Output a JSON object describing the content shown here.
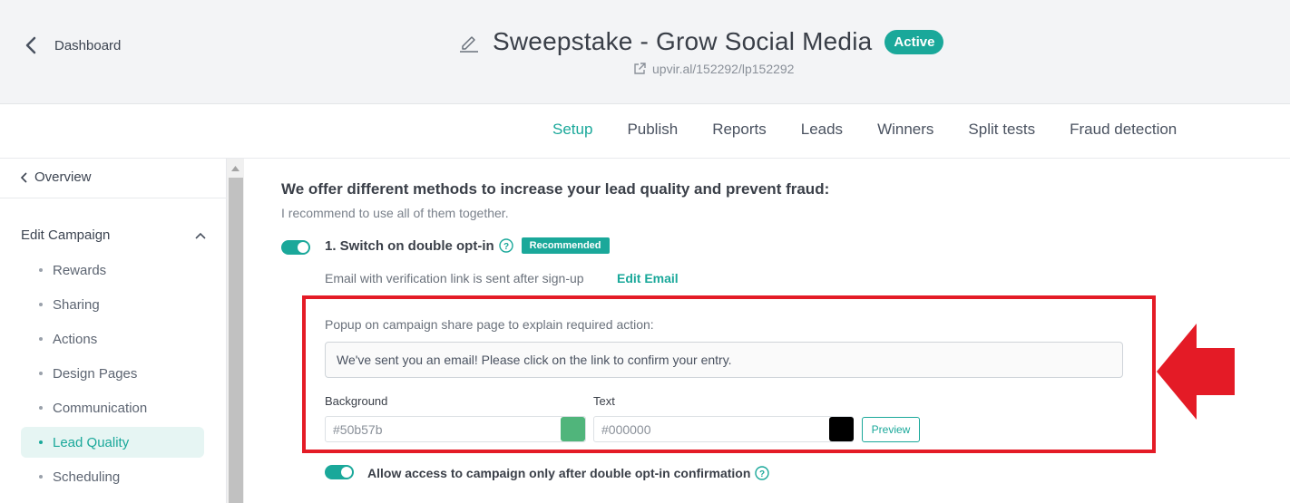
{
  "header": {
    "back_label": "Dashboard",
    "title": "Sweepstake - Grow Social Media",
    "status": "Active",
    "url": "upvir.al/152292/lp152292"
  },
  "tabs": [
    {
      "label": "Setup",
      "active": true
    },
    {
      "label": "Publish",
      "active": false
    },
    {
      "label": "Reports",
      "active": false
    },
    {
      "label": "Leads",
      "active": false
    },
    {
      "label": "Winners",
      "active": false
    },
    {
      "label": "Split tests",
      "active": false
    },
    {
      "label": "Fraud detection",
      "active": false
    }
  ],
  "sidebar": {
    "overview": "Overview",
    "group": "Edit Campaign",
    "items": [
      {
        "label": "Rewards"
      },
      {
        "label": "Sharing"
      },
      {
        "label": "Actions"
      },
      {
        "label": "Design Pages"
      },
      {
        "label": "Communication"
      },
      {
        "label": "Lead Quality",
        "active": true
      },
      {
        "label": "Scheduling"
      }
    ]
  },
  "main": {
    "title": "We offer different methods to increase your lead quality and prevent fraud:",
    "subtitle": "I recommend to use all of them together.",
    "option1": {
      "label": "1. Switch on double opt-in",
      "badge": "Recommended",
      "enabled": true,
      "verification_text": "Email with verification link is sent after sign-up",
      "edit_email": "Edit Email",
      "popup_label": "Popup on campaign share page to explain required action:",
      "popup_value": "We've sent you an email! Please click on the link to confirm your entry.",
      "background_label": "Background",
      "background_value": "#50b57b",
      "text_label": "Text",
      "text_value": "#000000",
      "preview": "Preview"
    },
    "option2": {
      "label": "Allow access to campaign only after double opt-in confirmation",
      "enabled": true
    }
  },
  "colors": {
    "accent": "#1aa89a",
    "highlight_box": "#e41b26",
    "background_swatch": "#50b57b",
    "text_swatch": "#000000"
  }
}
